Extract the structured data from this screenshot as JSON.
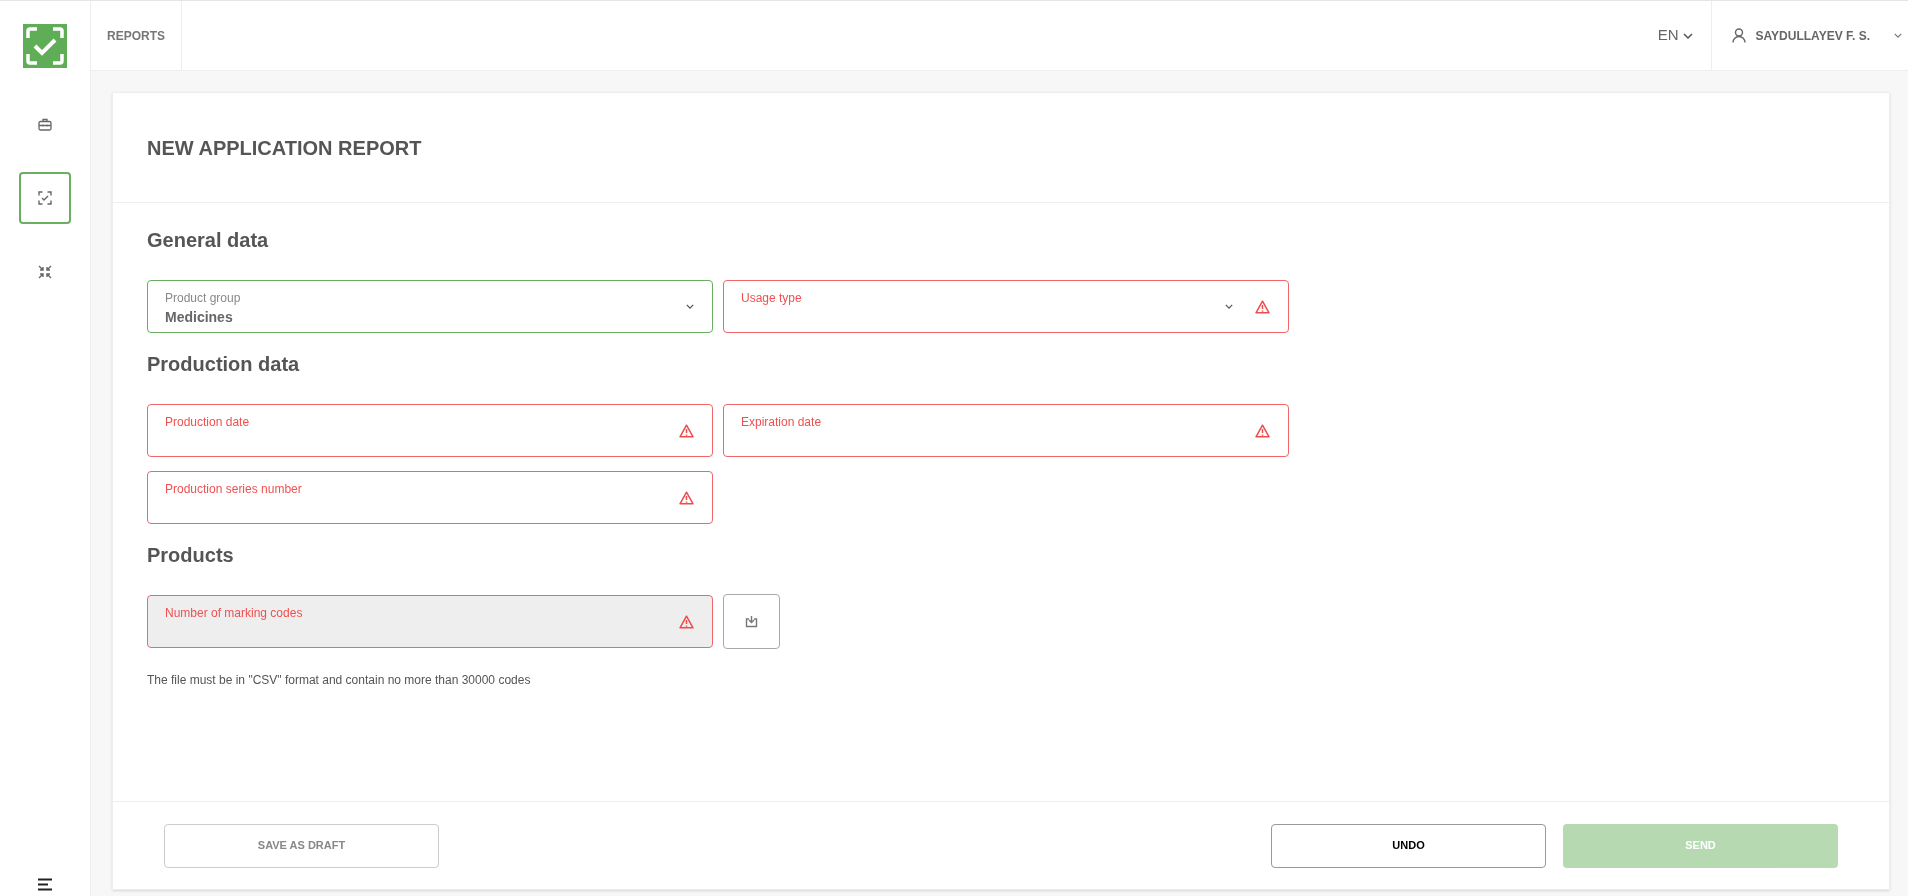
{
  "sidebar": {
    "items": [
      {
        "kind": "briefcase",
        "selected": false
      },
      {
        "kind": "scan",
        "selected": true
      },
      {
        "kind": "compress",
        "selected": false
      }
    ]
  },
  "header": {
    "tab": "REPORTS",
    "language": "EN",
    "user": "SAYDULLAYEV F. S."
  },
  "form": {
    "title": "NEW APPLICATION REPORT",
    "sections": [
      {
        "heading": "General data",
        "rows": [
          [
            {
              "kind": "select",
              "label": "Product group",
              "value": "Medicines",
              "invalid": false,
              "disabled": false
            },
            {
              "kind": "select",
              "label": "Usage type",
              "invalid": true,
              "disabled": false
            }
          ]
        ]
      },
      {
        "heading": "Production data",
        "rows": [
          [
            {
              "kind": "input",
              "label": "Production date",
              "invalid": true,
              "disabled": false
            },
            {
              "kind": "input",
              "label": "Expiration date",
              "invalid": true,
              "disabled": false
            }
          ],
          [
            {
              "kind": "input",
              "label": "Production series number",
              "invalid": true,
              "disabled": false
            }
          ]
        ]
      },
      {
        "heading": "Products",
        "rows": [
          [
            {
              "kind": "upload",
              "label": "Number of marking codes",
              "invalid": true,
              "disabled": true
            }
          ]
        ],
        "note": "The file must be in \"CSV\" format and contain no more than 30000 codes"
      }
    ]
  },
  "footer": {
    "buttons": [
      {
        "label": "SAVE AS DRAFT",
        "kind": "secondary",
        "disabled": false
      },
      {
        "label": "UNDO",
        "kind": "outline",
        "disabled": false
      },
      {
        "label": "SEND",
        "kind": "primary",
        "disabled": true
      }
    ]
  }
}
